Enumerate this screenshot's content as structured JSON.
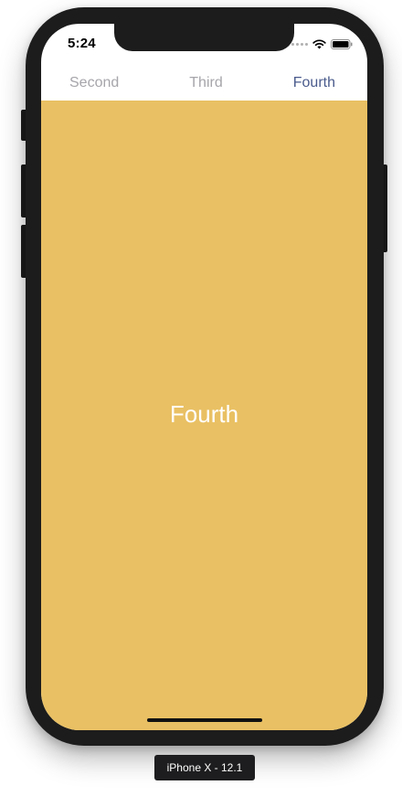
{
  "status_bar": {
    "time": "5:24"
  },
  "tab_bar": {
    "tabs": [
      {
        "label": "Second",
        "active": false
      },
      {
        "label": "Third",
        "active": false
      },
      {
        "label": "Fourth",
        "active": true
      }
    ]
  },
  "content": {
    "title": "Fourth"
  },
  "simulator": {
    "device_label": "iPhone X - 12.1"
  },
  "colors": {
    "content_background": "#e9c063",
    "active_tab": "#4a5b8c",
    "inactive_tab": "#a6a6ab",
    "device_frame": "#1c1c1c"
  },
  "icons": [
    "signal-dots-icon",
    "wifi-icon",
    "battery-icon"
  ]
}
